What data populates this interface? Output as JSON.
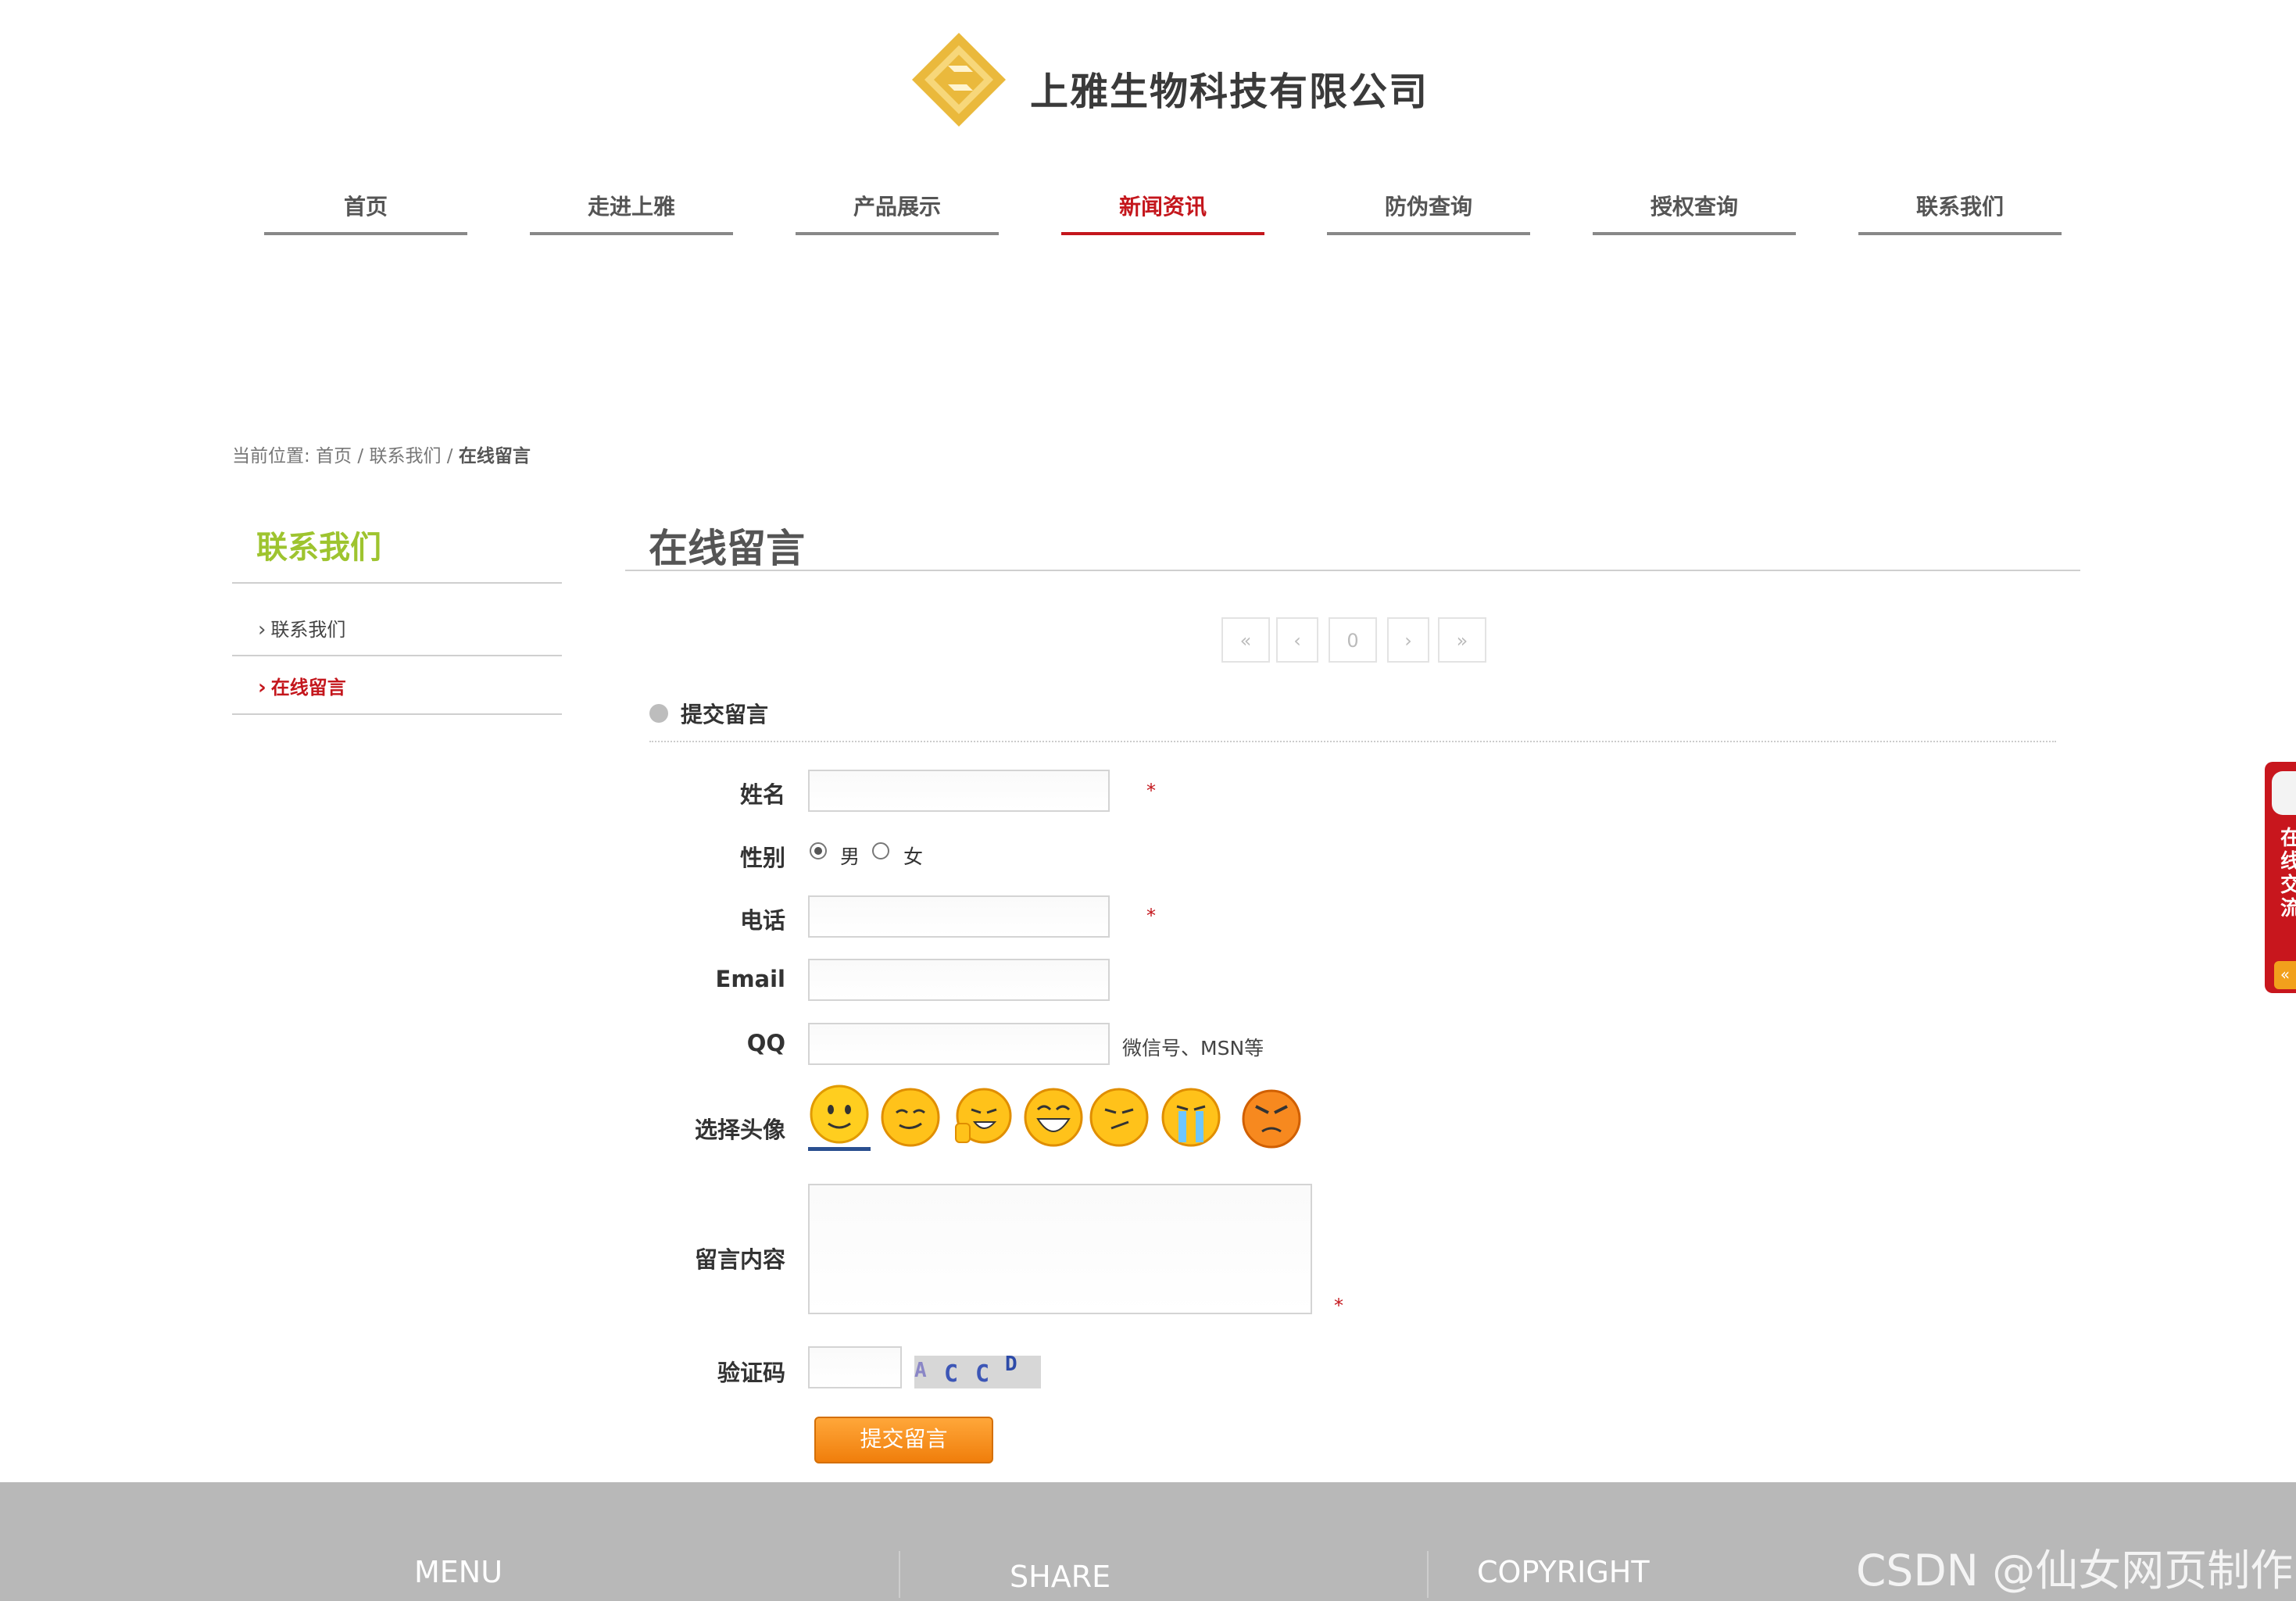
{
  "header": {
    "company_name": "上雅生物科技有限公司"
  },
  "nav": {
    "items": [
      {
        "label": "首页",
        "active": false
      },
      {
        "label": "走进上雅",
        "active": false
      },
      {
        "label": "产品展示",
        "active": false
      },
      {
        "label": "新闻资讯",
        "active": true
      },
      {
        "label": "防伪查询",
        "active": false
      },
      {
        "label": "授权查询",
        "active": false
      },
      {
        "label": "联系我们",
        "active": false
      }
    ]
  },
  "breadcrumb": {
    "prefix": "当前位置:",
    "home": "首页",
    "sep1": "/",
    "parent": "联系我们",
    "sep2": "/",
    "current": "在线留言"
  },
  "sidebar": {
    "title": "联系我们",
    "items": [
      {
        "label": "联系我们",
        "active": false
      },
      {
        "label": "在线留言",
        "active": true
      }
    ]
  },
  "main": {
    "title": "在线留言",
    "pager": {
      "first": "«",
      "prev": "‹",
      "page": "0",
      "next": "›",
      "last": "»"
    },
    "section_title": "提交留言"
  },
  "form": {
    "name": {
      "label": "姓名",
      "value": "",
      "required_mark": "*"
    },
    "gender": {
      "label": "性别",
      "options": [
        "男",
        "女"
      ],
      "selected": "男"
    },
    "phone": {
      "label": "电话",
      "value": "",
      "required_mark": "*"
    },
    "email": {
      "label": "Email",
      "value": ""
    },
    "qq": {
      "label": "QQ",
      "value": "",
      "hint": "微信号、MSN等"
    },
    "avatar": {
      "label": "选择头像",
      "selected_index": 0,
      "faces": [
        "smile-face-icon",
        "grin-face-icon",
        "thumbs-up-face-icon",
        "laugh-face-icon",
        "smirk-face-icon",
        "cry-face-icon",
        "angry-face-icon"
      ]
    },
    "content": {
      "label": "留言内容",
      "value": "",
      "required_mark": "*"
    },
    "captcha": {
      "label": "验证码",
      "value": "",
      "image_text": [
        "A",
        "C",
        "C",
        "D"
      ]
    },
    "submit_label": "提交留言"
  },
  "footer": {
    "menu": "MENU",
    "share": "SHARE",
    "copyright": "COPYRIGHT"
  },
  "chat_widget": {
    "text": [
      "在",
      "线",
      "交",
      "流"
    ],
    "arrow": "«"
  },
  "watermark": "CSDN @仙女网页制作",
  "colors": {
    "accent_red": "#c4161c",
    "sidebar_green": "#9ec42f",
    "button_orange": "#f5921e",
    "footer_gray": "#b8b8b8",
    "logo_gold": "#e9b93a"
  }
}
